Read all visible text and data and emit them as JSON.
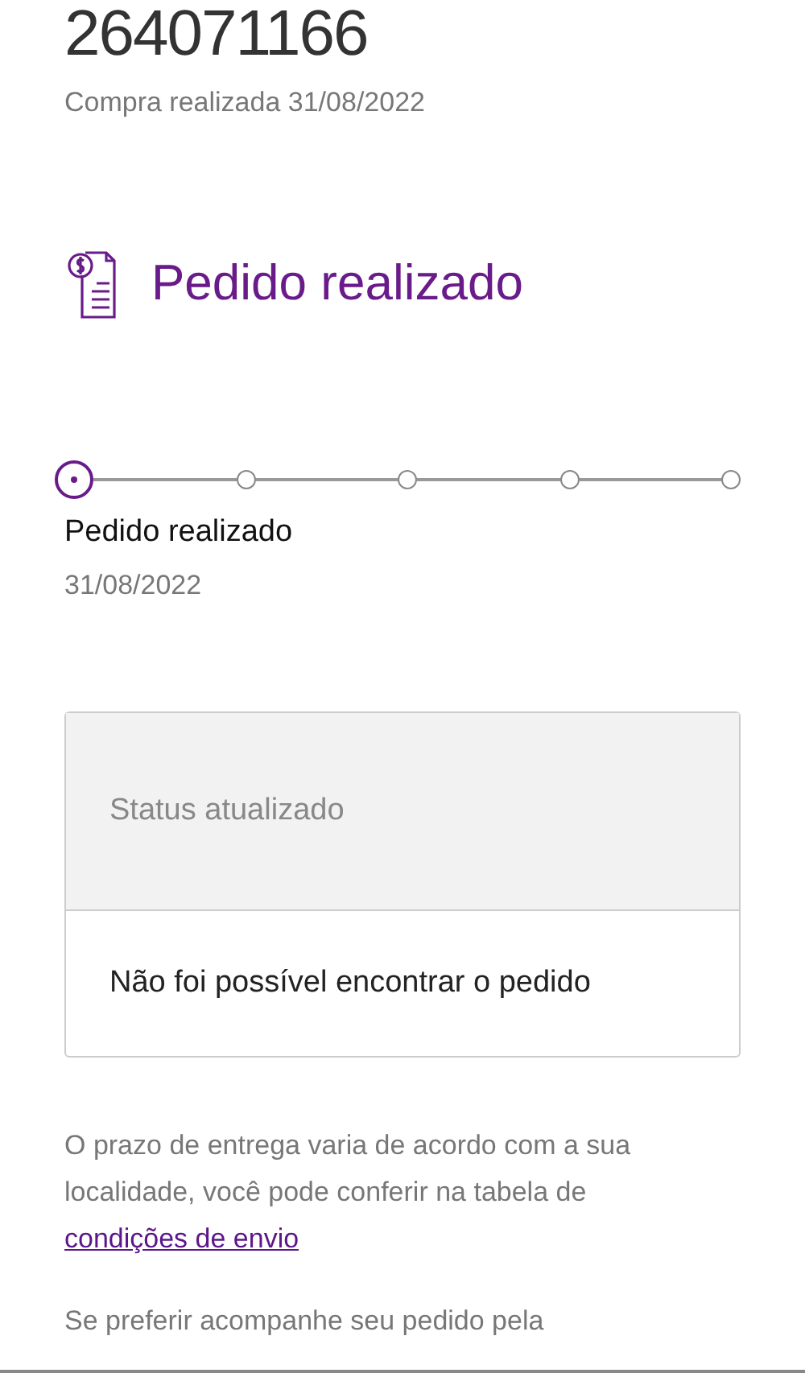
{
  "order_number": "264071166",
  "purchase_info": "Compra realizada 31/08/2022",
  "status_heading": "Pedido realizado",
  "progress": {
    "steps": [
      {
        "selected": true
      },
      {
        "selected": false
      },
      {
        "selected": false
      },
      {
        "selected": false
      },
      {
        "selected": false
      }
    ],
    "current_label": "Pedido realizado",
    "current_date": "31/08/2022"
  },
  "status_card": {
    "title": "Status atualizado",
    "message": "Não foi possível encontrar o pedido"
  },
  "delivery_note": {
    "text": "O prazo de entrega varia de acordo com a sua localidade, você pode conferir na tabela de ",
    "link": "condições de envio"
  },
  "tracking_note": "Se preferir acompanhe seu pedido pela"
}
